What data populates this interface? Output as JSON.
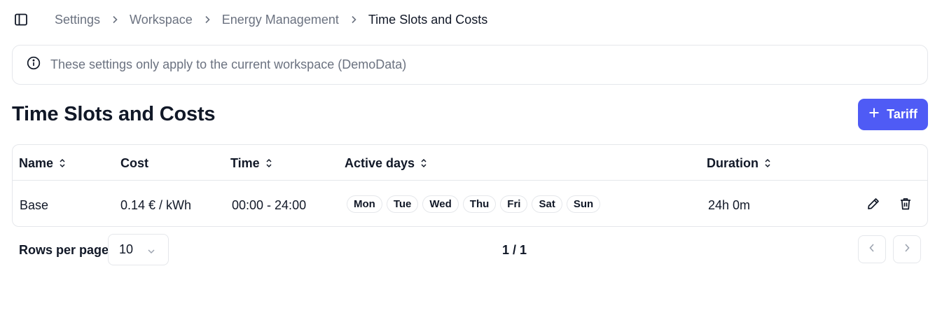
{
  "breadcrumb": {
    "items": [
      "Settings",
      "Workspace",
      "Energy Management",
      "Time Slots and Costs"
    ]
  },
  "notice": {
    "text": "These settings only apply to the current workspace (DemoData)"
  },
  "page": {
    "title": "Time Slots and Costs",
    "add_button_label": "Tariff"
  },
  "table": {
    "columns": {
      "name": "Name",
      "cost": "Cost",
      "time": "Time",
      "active_days": "Active days",
      "duration": "Duration"
    },
    "rows": [
      {
        "name": "Base",
        "cost": "0.14 € / kWh",
        "time": "00:00 - 24:00",
        "days": [
          "Mon",
          "Tue",
          "Wed",
          "Thu",
          "Fri",
          "Sat",
          "Sun"
        ],
        "duration": "24h 0m"
      }
    ]
  },
  "pagination": {
    "rows_per_page_label": "Rows per page",
    "rows_per_page_value": "10",
    "page_info": "1 / 1"
  },
  "colors": {
    "accent": "#4f5bf5",
    "border": "#e5e7eb",
    "muted_text": "#6b7280"
  }
}
